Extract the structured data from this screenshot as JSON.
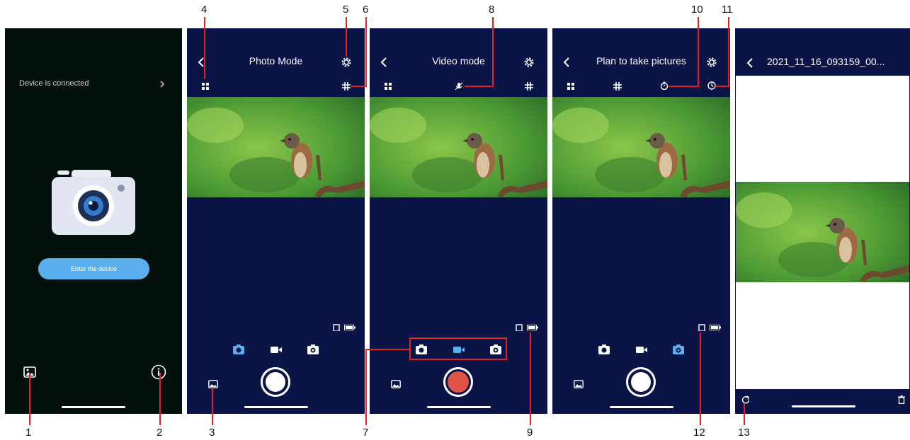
{
  "screen1": {
    "status_text": "Device is connected",
    "enter_button": "Enter the device"
  },
  "screen2": {
    "title": "Photo Mode"
  },
  "screen3": {
    "title": "Video mode"
  },
  "screen4": {
    "title": "Plan to take pictures"
  },
  "screen5": {
    "title": "2021_11_16_093159_00..."
  },
  "callouts": [
    "1",
    "2",
    "3",
    "4",
    "5",
    "6",
    "7",
    "8",
    "9",
    "10",
    "11",
    "12",
    "13"
  ],
  "colors": {
    "screen_bg": "#0a1446",
    "start_bg": "#04100b",
    "accent": "#5ab0ef",
    "record": "#e05246",
    "callout_line": "#e02424"
  }
}
